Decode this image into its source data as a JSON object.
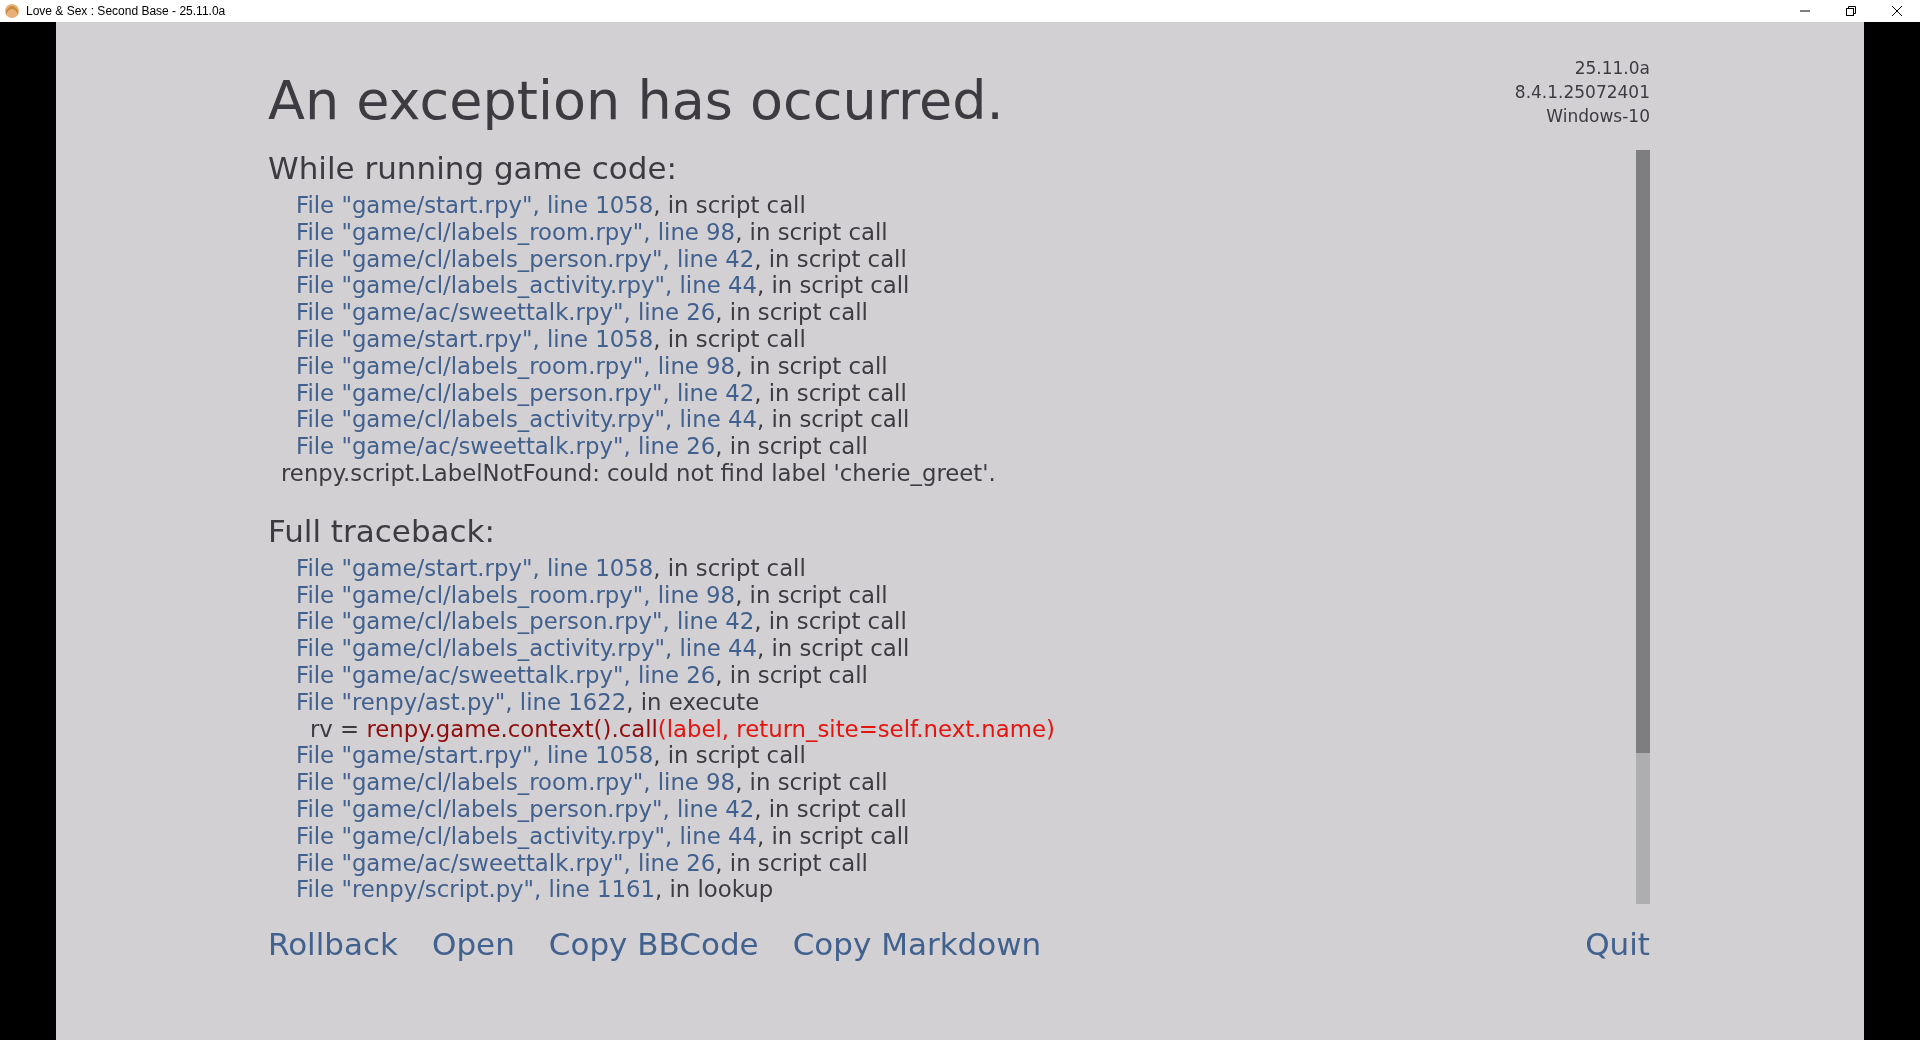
{
  "window": {
    "title": "Love & Sex : Second Base - 25.11.0a"
  },
  "heading": "An exception has occurred.",
  "version_info": [
    "25.11.0a",
    "8.4.1.25072401",
    "Windows-10"
  ],
  "sections": [
    {
      "heading": "While running game code:",
      "lines": [
        {
          "kind": "frame",
          "location": "File \"game/start.rpy\", line 1058",
          "context": ", in script call"
        },
        {
          "kind": "frame",
          "location": "File \"game/cl/labels_room.rpy\", line 98",
          "context": ", in script call"
        },
        {
          "kind": "frame",
          "location": "File \"game/cl/labels_person.rpy\", line 42",
          "context": ", in script call"
        },
        {
          "kind": "frame",
          "location": "File \"game/cl/labels_activity.rpy\", line 44",
          "context": ", in script call"
        },
        {
          "kind": "frame",
          "location": "File \"game/ac/sweettalk.rpy\", line 26",
          "context": ", in script call"
        },
        {
          "kind": "frame",
          "location": "File \"game/start.rpy\", line 1058",
          "context": ", in script call"
        },
        {
          "kind": "frame",
          "location": "File \"game/cl/labels_room.rpy\", line 98",
          "context": ", in script call"
        },
        {
          "kind": "frame",
          "location": "File \"game/cl/labels_person.rpy\", line 42",
          "context": ", in script call"
        },
        {
          "kind": "frame",
          "location": "File \"game/cl/labels_activity.rpy\", line 44",
          "context": ", in script call"
        },
        {
          "kind": "frame",
          "location": "File \"game/ac/sweettalk.rpy\", line 26",
          "context": ", in script call"
        },
        {
          "kind": "exception",
          "text": "renpy.script.LabelNotFound: could not find label 'cherie_greet'."
        }
      ]
    },
    {
      "heading": "Full traceback:",
      "lines": [
        {
          "kind": "frame",
          "location": "File \"game/start.rpy\", line 1058",
          "context": ", in script call"
        },
        {
          "kind": "frame",
          "location": "File \"game/cl/labels_room.rpy\", line 98",
          "context": ", in script call"
        },
        {
          "kind": "frame",
          "location": "File \"game/cl/labels_person.rpy\", line 42",
          "context": ", in script call"
        },
        {
          "kind": "frame",
          "location": "File \"game/cl/labels_activity.rpy\", line 44",
          "context": ", in script call"
        },
        {
          "kind": "frame",
          "location": "File \"game/ac/sweettalk.rpy\", line 26",
          "context": ", in script call"
        },
        {
          "kind": "frame",
          "location": "File \"renpy/ast.py\", line 1622",
          "context": ", in execute"
        },
        {
          "kind": "code",
          "prefix": "rv = ",
          "call": "renpy.game.context().call",
          "args": "(label, return_site=self.next.name)"
        },
        {
          "kind": "frame",
          "location": "File \"game/start.rpy\", line 1058",
          "context": ", in script call"
        },
        {
          "kind": "frame",
          "location": "File \"game/cl/labels_room.rpy\", line 98",
          "context": ", in script call"
        },
        {
          "kind": "frame",
          "location": "File \"game/cl/labels_person.rpy\", line 42",
          "context": ", in script call"
        },
        {
          "kind": "frame",
          "location": "File \"game/cl/labels_activity.rpy\", line 44",
          "context": ", in script call"
        },
        {
          "kind": "frame",
          "location": "File \"game/ac/sweettalk.rpy\", line 26",
          "context": ", in script call"
        },
        {
          "kind": "frame",
          "location": "File \"renpy/script.py\", line 1161",
          "context": ", in lookup"
        }
      ]
    }
  ],
  "buttons": [
    "Rollback",
    "Open",
    "Copy BBCode",
    "Copy Markdown"
  ],
  "quit_button": "Quit"
}
